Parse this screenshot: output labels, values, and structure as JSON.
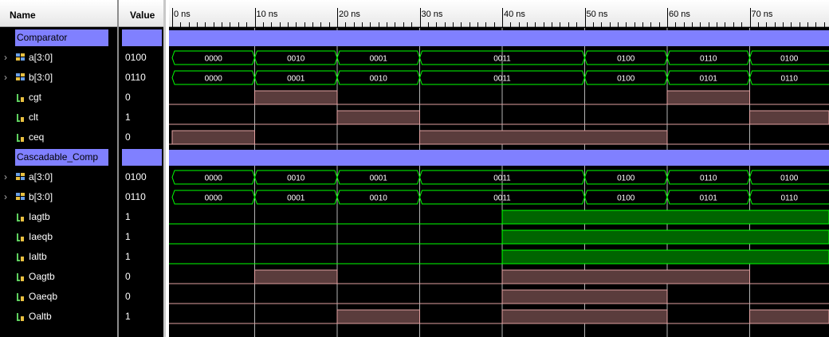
{
  "headers": {
    "name": "Name",
    "value": "Value"
  },
  "time_ticks": [
    "0 ns",
    "10 ns",
    "20 ns",
    "30 ns",
    "40 ns",
    "50 ns",
    "60 ns",
    "70 ns"
  ],
  "colors": {
    "group_bar": "#8080ff",
    "bus_line": "#00ff00",
    "bit_high_fill": "#5a3c3c",
    "bit_line_low": "#e0a0a0",
    "bit_line_high_green": "#00ff00",
    "bit_green_fill": "#006400",
    "grid_line": "#c0c0c0"
  },
  "rows": [
    {
      "kind": "group",
      "name": "Comparator"
    },
    {
      "kind": "bus",
      "name": "a[3:0]",
      "value": "0100",
      "segments": [
        {
          "from": 0,
          "to": 10,
          "label": "0000"
        },
        {
          "from": 10,
          "to": 20,
          "label": "0010"
        },
        {
          "from": 20,
          "to": 30,
          "label": "0001"
        },
        {
          "from": 30,
          "to": 50,
          "label": "0011"
        },
        {
          "from": 50,
          "to": 60,
          "label": "0100"
        },
        {
          "from": 60,
          "to": 70,
          "label": "0110"
        },
        {
          "from": 70,
          "to": 80,
          "label": "0100"
        }
      ]
    },
    {
      "kind": "bus",
      "name": "b[3:0]",
      "value": "0110",
      "segments": [
        {
          "from": 0,
          "to": 10,
          "label": "0000"
        },
        {
          "from": 10,
          "to": 20,
          "label": "0001"
        },
        {
          "from": 20,
          "to": 30,
          "label": "0010"
        },
        {
          "from": 30,
          "to": 50,
          "label": "0011"
        },
        {
          "from": 50,
          "to": 60,
          "label": "0100"
        },
        {
          "from": 60,
          "to": 70,
          "label": "0101"
        },
        {
          "from": 70,
          "to": 80,
          "label": "0110"
        }
      ]
    },
    {
      "kind": "bit",
      "name": "cgt",
      "value": "0",
      "high": [
        [
          10,
          20
        ],
        [
          60,
          70
        ]
      ]
    },
    {
      "kind": "bit",
      "name": "clt",
      "value": "1",
      "high": [
        [
          20,
          30
        ],
        [
          70,
          80
        ]
      ]
    },
    {
      "kind": "bit",
      "name": "ceq",
      "value": "0",
      "high": [
        [
          0,
          10
        ],
        [
          30,
          60
        ]
      ]
    },
    {
      "kind": "group",
      "name": "Cascadable_Comp"
    },
    {
      "kind": "bus",
      "name": "a[3:0]",
      "value": "0100",
      "segments": [
        {
          "from": 0,
          "to": 10,
          "label": "0000"
        },
        {
          "from": 10,
          "to": 20,
          "label": "0010"
        },
        {
          "from": 20,
          "to": 30,
          "label": "0001"
        },
        {
          "from": 30,
          "to": 50,
          "label": "0011"
        },
        {
          "from": 50,
          "to": 60,
          "label": "0100"
        },
        {
          "from": 60,
          "to": 70,
          "label": "0110"
        },
        {
          "from": 70,
          "to": 80,
          "label": "0100"
        }
      ]
    },
    {
      "kind": "bus",
      "name": "b[3:0]",
      "value": "0110",
      "segments": [
        {
          "from": 0,
          "to": 10,
          "label": "0000"
        },
        {
          "from": 10,
          "to": 20,
          "label": "0001"
        },
        {
          "from": 20,
          "to": 30,
          "label": "0010"
        },
        {
          "from": 30,
          "to": 50,
          "label": "0011"
        },
        {
          "from": 50,
          "to": 60,
          "label": "0100"
        },
        {
          "from": 60,
          "to": 70,
          "label": "0101"
        },
        {
          "from": 70,
          "to": 80,
          "label": "0110"
        }
      ]
    },
    {
      "kind": "bit",
      "name": "Iagtb",
      "value": "1",
      "green": true,
      "high": [
        [
          40,
          80
        ]
      ]
    },
    {
      "kind": "bit",
      "name": "Iaeqb",
      "value": "1",
      "green": true,
      "high": [
        [
          40,
          80
        ]
      ]
    },
    {
      "kind": "bit",
      "name": "Ialtb",
      "value": "1",
      "green": true,
      "high": [
        [
          40,
          80
        ]
      ]
    },
    {
      "kind": "bit",
      "name": "Oagtb",
      "value": "0",
      "high": [
        [
          10,
          20
        ],
        [
          40,
          70
        ]
      ]
    },
    {
      "kind": "bit",
      "name": "Oaeqb",
      "value": "0",
      "high": [
        [
          40,
          60
        ]
      ]
    },
    {
      "kind": "bit",
      "name": "Oaltb",
      "value": "1",
      "high": [
        [
          20,
          30
        ],
        [
          40,
          60
        ],
        [
          70,
          80
        ]
      ]
    }
  ]
}
